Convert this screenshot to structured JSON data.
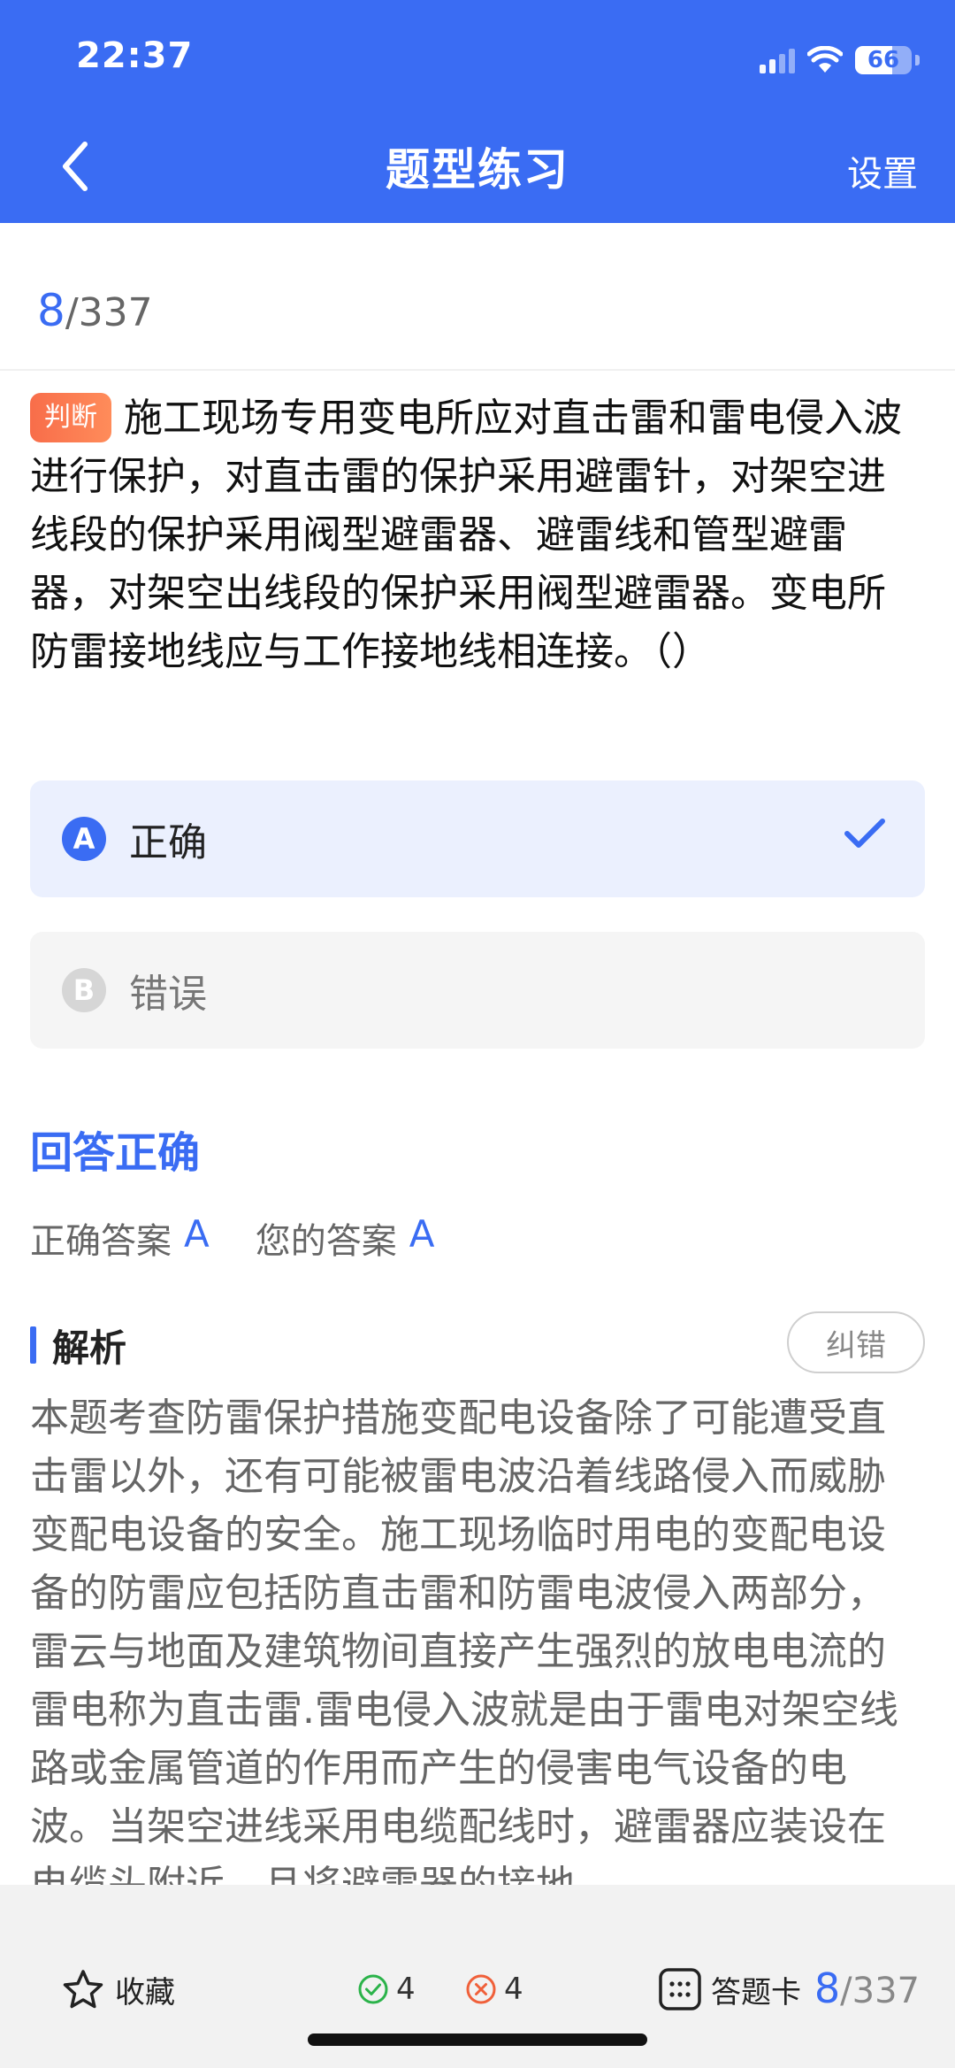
{
  "status_bar": {
    "time": "22:37",
    "battery": "66",
    "battery_level": 0.66
  },
  "nav": {
    "title": "题型练习",
    "settings_label": "设置"
  },
  "progress": {
    "current": "8",
    "total": "/337"
  },
  "question": {
    "type_tag": "判断",
    "text": "施工现场专用变电所应对直击雷和雷电侵入波进行保护，对直击雷的保护采用避雷针，对架空进线段的保护采用阀型避雷器、避雷线和管型避雷器，对架空出线段的保护采用阀型避雷器。变电所防雷接地线应与工作接地线相连接。（）"
  },
  "options": [
    {
      "letter": "A",
      "text": "正确",
      "selected": true
    },
    {
      "letter": "B",
      "text": "错误",
      "selected": false
    }
  ],
  "result": {
    "title": "回答正确",
    "correct_label": "正确答案",
    "correct_value": "A",
    "your_label": "您的答案",
    "your_value": "A"
  },
  "analysis": {
    "title": "解析",
    "report_label": "纠错",
    "text": "本题考查防雷保护措施变配电设备除了可能遭受直击雷以外，还有可能被雷电波沿着线路侵入而威胁变配电设备的安全。施工现场临时用电的变配电设备的防雷应包括防直击雷和防雷电波侵入两部分，雷云与地面及建筑物间直接产生强烈的放电电流的雷电称为直击雷.雷电侵入波就是由于雷电对架空线路或金属管道的作用而产生的侵害电气设备的电波。当架空进线采用电缆配线时，避雷器应装设在电缆头附近，且将避雷器的接地"
  },
  "bottom_bar": {
    "favorite_label": "收藏",
    "correct_count": "4",
    "wrong_count": "4",
    "answer_card_label": "答题卡",
    "progress_current": "8",
    "progress_total": "/337"
  },
  "colors": {
    "accent": "#3a6cf3",
    "tag": "#f86d4a",
    "correct": "#2bb34a",
    "wrong": "#f0603a"
  }
}
